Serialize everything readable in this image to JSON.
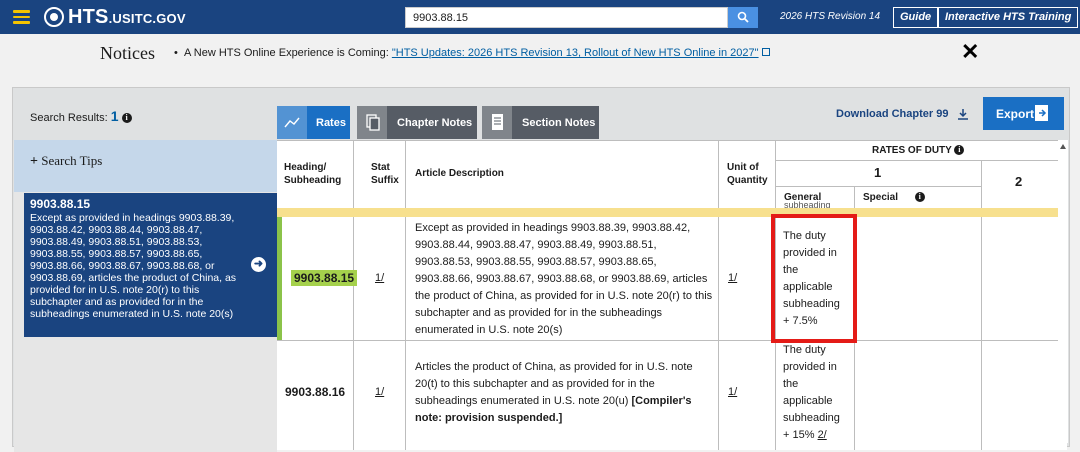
{
  "topbar": {
    "brand": "HTS",
    "brand_suffix": ".USITC.GOV",
    "search_value": "9903.88.15",
    "revision": "2026 HTS Revision 14",
    "guide_label": "Guide",
    "training_label": "Interactive HTS Training"
  },
  "notices": {
    "title": "Notices",
    "prefix": "A New HTS Online Experience is Coming:",
    "link": "\"HTS Updates: 2026 HTS Revision 13, Rollout of New HTS Online in 2027\"",
    "close": "✕"
  },
  "toolbar": {
    "results_label": "Search Results:",
    "results_count": "1",
    "tabs": [
      {
        "label": "Rates",
        "active": true
      },
      {
        "label": "Chapter Notes",
        "active": false
      },
      {
        "label": "Section Notes",
        "active": false
      }
    ],
    "download_label": "Download Chapter 99",
    "export_label": "Export"
  },
  "sidebar": {
    "tips_label": "Search Tips",
    "card": {
      "heading": "9903.88.15",
      "description": "Except as provided in headings 9903.88.39, 9903.88.42, 9903.88.44, 9903.88.47, 9903.88.49, 9903.88.51, 9903.88.53, 9903.88.55, 9903.88.57, 9903.88.65, 9903.88.66, 9903.88.67, 9903.88.68, or 9903.88.69, articles the product of China, as provided for in U.S. note 20(r) to this subchapter and as provided for in the subheadings enumerated in U.S. note 20(s)"
    }
  },
  "table": {
    "headers": {
      "heading": "Heading/ Subheading",
      "suffix": "Stat Suffix",
      "description": "Article Description",
      "unit": "Unit of Quantity",
      "rates": "RATES OF DUTY",
      "col1": "1",
      "col2": "2",
      "general": "General",
      "special": "Special",
      "cut_text": "subheading"
    },
    "rows": [
      {
        "heading": "9903.88.15",
        "suffix": "1/",
        "description": "Except as provided in headings 9903.88.39, 9903.88.42, 9903.88.44, 9903.88.47, 9903.88.49, 9903.88.51, 9903.88.53, 9903.88.55, 9903.88.57, 9903.88.65, 9903.88.66, 9903.88.67, 9903.88.68, or 9903.88.69, articles the product of China, as provided for in U.S. note 20(r) to this subchapter and as provided for in the subheadings enumerated in U.S. note 20(s)",
        "unit": "1/",
        "general": "The duty provided in the applicable subheading + 7.5%"
      },
      {
        "heading": "9903.88.16",
        "suffix": "1/",
        "description": "Articles the product of China, as provided for in U.S. note 20(t) to this subchapter and as provided for in the subheadings enumerated in U.S. note 20(u)",
        "description_bold": "[Compiler's note: provision suspended.]",
        "unit": "1/",
        "general": "The duty provided in the applicable subheading + 15%",
        "general_note": "2/"
      }
    ]
  }
}
